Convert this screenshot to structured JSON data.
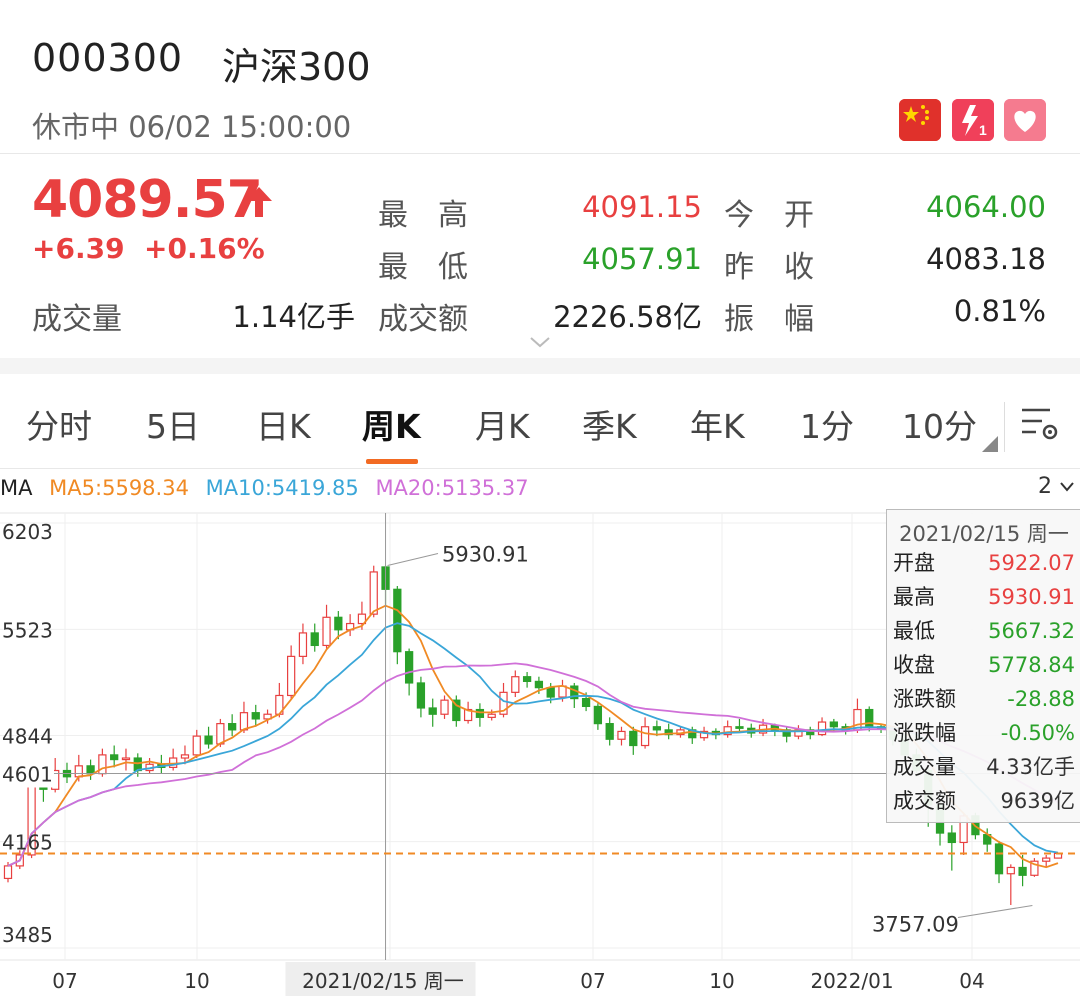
{
  "header": {
    "code": "000300",
    "name": "沪深300",
    "status": "休市中 06/02 15:00:00",
    "icons": [
      "china-flag-icon",
      "lightning-1-icon",
      "heart-icon"
    ]
  },
  "quote": {
    "price": "4089.57",
    "change": "+6.39",
    "change_pct": "+0.16%",
    "volume_label": "成交量",
    "volume": "1.14亿手",
    "high_label": "最　高",
    "high": "4091.15",
    "low_label": "最　低",
    "low": "4057.91",
    "amount_label": "成交额",
    "amount": "2226.58亿",
    "open_label": "今　开",
    "open": "4064.00",
    "prev_close_label": "昨　收",
    "prev_close": "4083.18",
    "amplitude_label": "振　幅",
    "amplitude": "0.81%"
  },
  "tabs": [
    "分时",
    "5日",
    "日K",
    "周K",
    "月K",
    "季K",
    "年K",
    "1分",
    "10分"
  ],
  "ma_bar": {
    "label": "MA",
    "ma5": "MA5:5598.34",
    "ma10": "MA10:5419.85",
    "ma20": "MA20:5135.37",
    "zoom": "2"
  },
  "colors": {
    "up": "#e84040",
    "down": "#2aa12a",
    "ma5": "#f08a24",
    "ma10": "#3aa6d8",
    "ma20": "#d070d8",
    "accent": "#f26a22"
  },
  "tooltip": {
    "date": "2021/02/15 周一",
    "rows": [
      {
        "label": "开盘",
        "value": "5922.07",
        "color": "red"
      },
      {
        "label": "最高",
        "value": "5930.91",
        "color": "red"
      },
      {
        "label": "最低",
        "value": "5667.32",
        "color": "green"
      },
      {
        "label": "收盘",
        "value": "5778.84",
        "color": "green"
      },
      {
        "label": "涨跌额",
        "value": "-28.88",
        "color": "green"
      },
      {
        "label": "涨跌幅",
        "value": "-0.50%",
        "color": "green"
      },
      {
        "label": "成交量",
        "value": "4.33亿手",
        "color": "dark"
      },
      {
        "label": "成交额",
        "value": "9639亿",
        "color": "dark"
      }
    ]
  },
  "chart_data": {
    "type": "candlestick",
    "y_ticks": [
      "6203",
      "5523",
      "4844",
      "4601",
      "4165",
      "3485"
    ],
    "x_ticks": [
      "07",
      "10",
      "2021/02/15 周一",
      "07",
      "10",
      "2022/01",
      "04"
    ],
    "ylim": [
      3485,
      6203
    ],
    "annotations": [
      {
        "text": "5930.91",
        "value": 5930.91
      },
      {
        "text": "3757.09",
        "value": 3757.09
      }
    ],
    "crosshair_value": 4601,
    "last_close_line": 4089.57,
    "candles": [
      [
        3930,
        4010,
        3905,
        4035
      ],
      [
        4010,
        4080,
        3990,
        4110
      ],
      [
        4080,
        4560,
        4060,
        4640
      ],
      [
        4560,
        4500,
        4420,
        4600
      ],
      [
        4500,
        4620,
        4480,
        4700
      ],
      [
        4620,
        4580,
        4540,
        4670
      ],
      [
        4580,
        4650,
        4550,
        4720
      ],
      [
        4650,
        4600,
        4560,
        4690
      ],
      [
        4600,
        4720,
        4580,
        4760
      ],
      [
        4720,
        4690,
        4640,
        4780
      ],
      [
        4690,
        4700,
        4620,
        4760
      ],
      [
        4700,
        4620,
        4580,
        4730
      ],
      [
        4620,
        4660,
        4600,
        4700
      ],
      [
        4660,
        4640,
        4600,
        4720
      ],
      [
        4640,
        4700,
        4620,
        4760
      ],
      [
        4700,
        4720,
        4660,
        4780
      ],
      [
        4720,
        4840,
        4700,
        4880
      ],
      [
        4840,
        4790,
        4760,
        4900
      ],
      [
        4790,
        4920,
        4770,
        4950
      ],
      [
        4920,
        4880,
        4840,
        4980
      ],
      [
        4880,
        4990,
        4860,
        5060
      ],
      [
        4990,
        4950,
        4900,
        5040
      ],
      [
        4950,
        4980,
        4920,
        5010
      ],
      [
        4980,
        5100,
        4960,
        5180
      ],
      [
        5100,
        5350,
        5080,
        5420
      ],
      [
        5350,
        5500,
        5300,
        5560
      ],
      [
        5500,
        5420,
        5380,
        5560
      ],
      [
        5420,
        5600,
        5400,
        5680
      ],
      [
        5600,
        5520,
        5460,
        5640
      ],
      [
        5520,
        5560,
        5480,
        5620
      ],
      [
        5560,
        5620,
        5520,
        5700
      ],
      [
        5620,
        5890,
        5600,
        5930
      ],
      [
        5922,
        5779,
        5667,
        5931
      ],
      [
        5779,
        5380,
        5300,
        5800
      ],
      [
        5380,
        5180,
        5100,
        5400
      ],
      [
        5180,
        5020,
        4960,
        5220
      ],
      [
        5020,
        4980,
        4900,
        5080
      ],
      [
        4980,
        5070,
        4950,
        5100
      ],
      [
        5070,
        4940,
        4900,
        5100
      ],
      [
        4940,
        5010,
        4920,
        5060
      ],
      [
        5010,
        4960,
        4900,
        5050
      ],
      [
        4960,
        4980,
        4940,
        5010
      ],
      [
        4980,
        5120,
        4960,
        5180
      ],
      [
        5120,
        5220,
        5090,
        5260
      ],
      [
        5220,
        5190,
        5150,
        5250
      ],
      [
        5190,
        5150,
        5110,
        5220
      ],
      [
        5150,
        5090,
        5050,
        5180
      ],
      [
        5090,
        5160,
        5060,
        5200
      ],
      [
        5160,
        5080,
        5020,
        5180
      ],
      [
        5080,
        5030,
        5000,
        5120
      ],
      [
        5030,
        4920,
        4880,
        5050
      ],
      [
        4920,
        4820,
        4780,
        4960
      ],
      [
        4820,
        4870,
        4780,
        4900
      ],
      [
        4870,
        4780,
        4720,
        4900
      ],
      [
        4780,
        4900,
        4760,
        4960
      ],
      [
        4900,
        4880,
        4840,
        4940
      ],
      [
        4880,
        4850,
        4820,
        4920
      ],
      [
        4850,
        4880,
        4830,
        4900
      ],
      [
        4880,
        4830,
        4790,
        4900
      ],
      [
        4830,
        4870,
        4810,
        4900
      ],
      [
        4870,
        4850,
        4820,
        4890
      ],
      [
        4850,
        4900,
        4830,
        4940
      ],
      [
        4900,
        4890,
        4860,
        4950
      ],
      [
        4890,
        4860,
        4830,
        4920
      ],
      [
        4860,
        4910,
        4840,
        4950
      ],
      [
        4910,
        4880,
        4840,
        4920
      ],
      [
        4880,
        4840,
        4800,
        4900
      ],
      [
        4840,
        4880,
        4820,
        4910
      ],
      [
        4880,
        4850,
        4820,
        4900
      ],
      [
        4850,
        4930,
        4840,
        4960
      ],
      [
        4930,
        4900,
        4870,
        4950
      ],
      [
        4900,
        4880,
        4850,
        4920
      ],
      [
        4880,
        5010,
        4860,
        5080
      ],
      [
        5010,
        4900,
        4870,
        5030
      ],
      [
        4900,
        4890,
        4860,
        4920
      ],
      [
        4890,
        4820,
        4780,
        4900
      ],
      [
        4820,
        4720,
        4680,
        4850
      ],
      [
        4720,
        4620,
        4580,
        4760
      ],
      [
        4620,
        4400,
        4260,
        4640
      ],
      [
        4400,
        4220,
        4140,
        4420
      ],
      [
        4220,
        4160,
        3980,
        4270
      ],
      [
        4160,
        4330,
        4080,
        4350
      ],
      [
        4330,
        4210,
        4180,
        4350
      ],
      [
        4210,
        4150,
        4100,
        4250
      ],
      [
        4150,
        3960,
        3900,
        4170
      ],
      [
        3960,
        4000,
        3760,
        4020
      ],
      [
        4000,
        3950,
        3880,
        4080
      ],
      [
        3950,
        4040,
        3940,
        4060
      ],
      [
        4040,
        4060,
        4000,
        4080
      ],
      [
        4060,
        4090,
        4057,
        4092
      ]
    ]
  }
}
